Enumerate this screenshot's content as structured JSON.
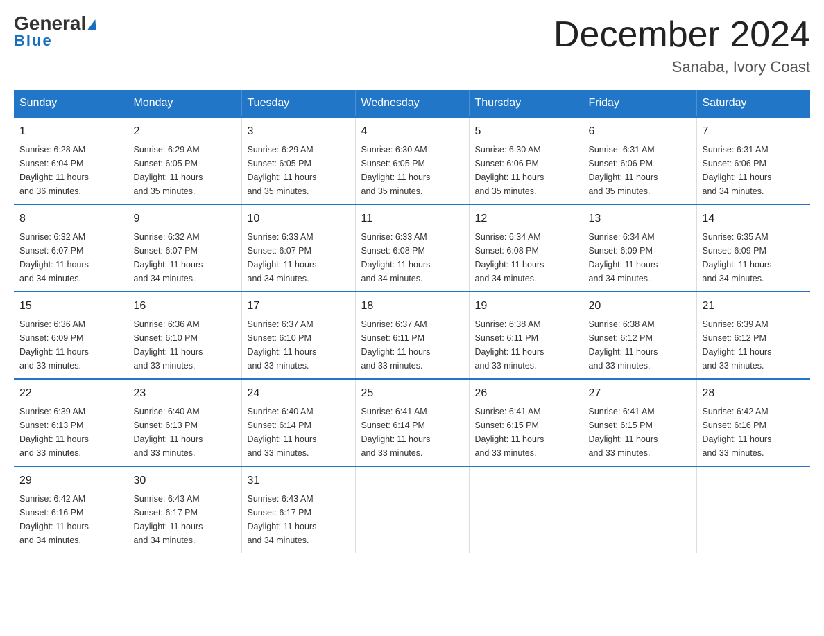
{
  "logo": {
    "part1": "General",
    "part2": "Blue"
  },
  "title": "December 2024",
  "location": "Sanaba, Ivory Coast",
  "days_of_week": [
    "Sunday",
    "Monday",
    "Tuesday",
    "Wednesday",
    "Thursday",
    "Friday",
    "Saturday"
  ],
  "weeks": [
    [
      {
        "day": "1",
        "info": "Sunrise: 6:28 AM\nSunset: 6:04 PM\nDaylight: 11 hours\nand 36 minutes."
      },
      {
        "day": "2",
        "info": "Sunrise: 6:29 AM\nSunset: 6:05 PM\nDaylight: 11 hours\nand 35 minutes."
      },
      {
        "day": "3",
        "info": "Sunrise: 6:29 AM\nSunset: 6:05 PM\nDaylight: 11 hours\nand 35 minutes."
      },
      {
        "day": "4",
        "info": "Sunrise: 6:30 AM\nSunset: 6:05 PM\nDaylight: 11 hours\nand 35 minutes."
      },
      {
        "day": "5",
        "info": "Sunrise: 6:30 AM\nSunset: 6:06 PM\nDaylight: 11 hours\nand 35 minutes."
      },
      {
        "day": "6",
        "info": "Sunrise: 6:31 AM\nSunset: 6:06 PM\nDaylight: 11 hours\nand 35 minutes."
      },
      {
        "day": "7",
        "info": "Sunrise: 6:31 AM\nSunset: 6:06 PM\nDaylight: 11 hours\nand 34 minutes."
      }
    ],
    [
      {
        "day": "8",
        "info": "Sunrise: 6:32 AM\nSunset: 6:07 PM\nDaylight: 11 hours\nand 34 minutes."
      },
      {
        "day": "9",
        "info": "Sunrise: 6:32 AM\nSunset: 6:07 PM\nDaylight: 11 hours\nand 34 minutes."
      },
      {
        "day": "10",
        "info": "Sunrise: 6:33 AM\nSunset: 6:07 PM\nDaylight: 11 hours\nand 34 minutes."
      },
      {
        "day": "11",
        "info": "Sunrise: 6:33 AM\nSunset: 6:08 PM\nDaylight: 11 hours\nand 34 minutes."
      },
      {
        "day": "12",
        "info": "Sunrise: 6:34 AM\nSunset: 6:08 PM\nDaylight: 11 hours\nand 34 minutes."
      },
      {
        "day": "13",
        "info": "Sunrise: 6:34 AM\nSunset: 6:09 PM\nDaylight: 11 hours\nand 34 minutes."
      },
      {
        "day": "14",
        "info": "Sunrise: 6:35 AM\nSunset: 6:09 PM\nDaylight: 11 hours\nand 34 minutes."
      }
    ],
    [
      {
        "day": "15",
        "info": "Sunrise: 6:36 AM\nSunset: 6:09 PM\nDaylight: 11 hours\nand 33 minutes."
      },
      {
        "day": "16",
        "info": "Sunrise: 6:36 AM\nSunset: 6:10 PM\nDaylight: 11 hours\nand 33 minutes."
      },
      {
        "day": "17",
        "info": "Sunrise: 6:37 AM\nSunset: 6:10 PM\nDaylight: 11 hours\nand 33 minutes."
      },
      {
        "day": "18",
        "info": "Sunrise: 6:37 AM\nSunset: 6:11 PM\nDaylight: 11 hours\nand 33 minutes."
      },
      {
        "day": "19",
        "info": "Sunrise: 6:38 AM\nSunset: 6:11 PM\nDaylight: 11 hours\nand 33 minutes."
      },
      {
        "day": "20",
        "info": "Sunrise: 6:38 AM\nSunset: 6:12 PM\nDaylight: 11 hours\nand 33 minutes."
      },
      {
        "day": "21",
        "info": "Sunrise: 6:39 AM\nSunset: 6:12 PM\nDaylight: 11 hours\nand 33 minutes."
      }
    ],
    [
      {
        "day": "22",
        "info": "Sunrise: 6:39 AM\nSunset: 6:13 PM\nDaylight: 11 hours\nand 33 minutes."
      },
      {
        "day": "23",
        "info": "Sunrise: 6:40 AM\nSunset: 6:13 PM\nDaylight: 11 hours\nand 33 minutes."
      },
      {
        "day": "24",
        "info": "Sunrise: 6:40 AM\nSunset: 6:14 PM\nDaylight: 11 hours\nand 33 minutes."
      },
      {
        "day": "25",
        "info": "Sunrise: 6:41 AM\nSunset: 6:14 PM\nDaylight: 11 hours\nand 33 minutes."
      },
      {
        "day": "26",
        "info": "Sunrise: 6:41 AM\nSunset: 6:15 PM\nDaylight: 11 hours\nand 33 minutes."
      },
      {
        "day": "27",
        "info": "Sunrise: 6:41 AM\nSunset: 6:15 PM\nDaylight: 11 hours\nand 33 minutes."
      },
      {
        "day": "28",
        "info": "Sunrise: 6:42 AM\nSunset: 6:16 PM\nDaylight: 11 hours\nand 33 minutes."
      }
    ],
    [
      {
        "day": "29",
        "info": "Sunrise: 6:42 AM\nSunset: 6:16 PM\nDaylight: 11 hours\nand 34 minutes."
      },
      {
        "day": "30",
        "info": "Sunrise: 6:43 AM\nSunset: 6:17 PM\nDaylight: 11 hours\nand 34 minutes."
      },
      {
        "day": "31",
        "info": "Sunrise: 6:43 AM\nSunset: 6:17 PM\nDaylight: 11 hours\nand 34 minutes."
      },
      {
        "day": "",
        "info": ""
      },
      {
        "day": "",
        "info": ""
      },
      {
        "day": "",
        "info": ""
      },
      {
        "day": "",
        "info": ""
      }
    ]
  ]
}
